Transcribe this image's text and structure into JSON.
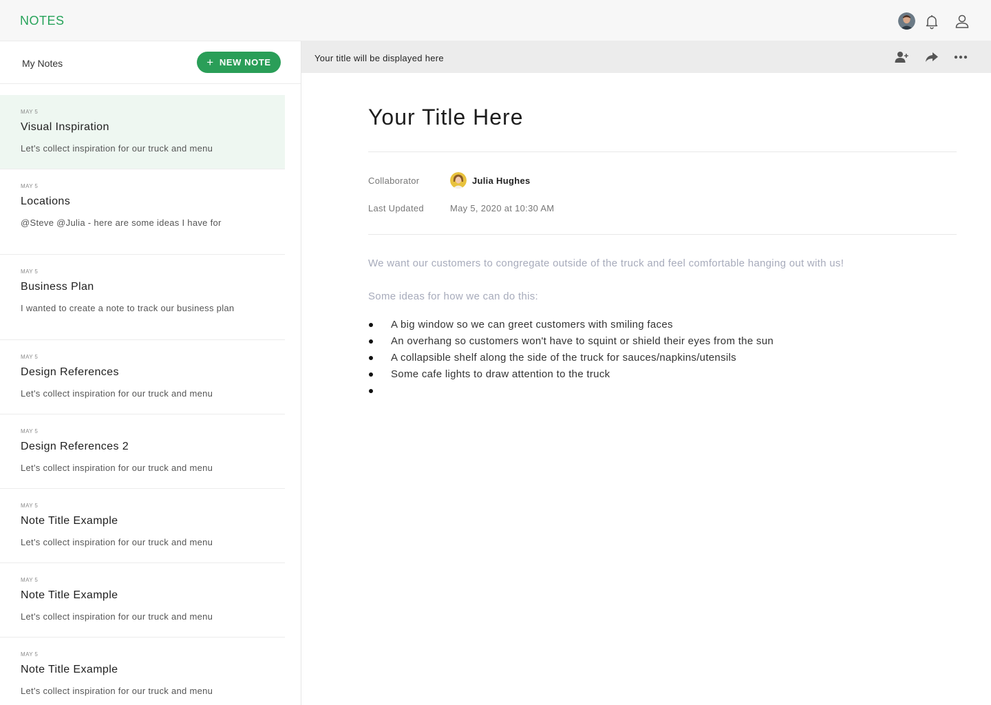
{
  "app": {
    "brand": "NOTES",
    "brand_color": "#27a35a"
  },
  "topbar": {
    "avatar_icon": "user-photo-avatar",
    "bell_icon": "bell-icon",
    "account_icon": "user-icon"
  },
  "sidebar": {
    "heading": "My Notes",
    "new_note": {
      "label": "NEW NOTE",
      "icon": "plus-icon",
      "color": "#2a9e58"
    },
    "notes": [
      {
        "date": "MAY 5",
        "title": "Visual Inspiration",
        "snippet": "Let's collect inspiration for our truck and menu",
        "active": true
      },
      {
        "date": "MAY 5",
        "title": "Locations",
        "snippet": "@Steve @Julia - here are some ideas I have for",
        "active": false
      },
      {
        "date": "MAY 5",
        "title": "Business Plan",
        "snippet": "I wanted to create a note to track our business plan",
        "active": false
      },
      {
        "date": "MAY 5",
        "title": "Design References",
        "snippet": "Let's collect inspiration for our truck and menu",
        "active": false
      },
      {
        "date": "MAY 5",
        "title": "Design References 2",
        "snippet": "Let's collect inspiration for our truck and menu",
        "active": false
      },
      {
        "date": "MAY 5",
        "title": "Note Title Example",
        "snippet": "Let's collect inspiration for our truck and menu",
        "active": false
      },
      {
        "date": "MAY 5",
        "title": "Note Title Example",
        "snippet": "Let's collect inspiration for our truck and menu",
        "active": false
      },
      {
        "date": "MAY 5",
        "title": "Note Title Example",
        "snippet": "Let's collect inspiration for our truck and menu",
        "active": false
      }
    ]
  },
  "main": {
    "toolbar": {
      "title": "Your title will be displayed here",
      "icons": [
        "add-user-icon",
        "share-icon",
        "more-icon"
      ]
    },
    "title": "Your Title Here",
    "meta": {
      "collaborator_label": "Collaborator",
      "collaborator_name": "Julia Hughes",
      "updated_label": "Last Updated",
      "updated_value": "May 5, 2020 at 10:30 AM"
    },
    "paragraph1": "We want our customers to congregate outside of the truck and feel comfortable hanging out with us!",
    "paragraph2": "Some ideas for how we can do this:",
    "bullets": [
      "A big window so we can greet customers with smiling faces",
      "An overhang so customers won't have to squint or shield their eyes from the sun",
      "A collapsible shelf along the side of the truck for sauces/napkins/utensils",
      "Some cafe lights to draw attention to the truck",
      ""
    ]
  }
}
